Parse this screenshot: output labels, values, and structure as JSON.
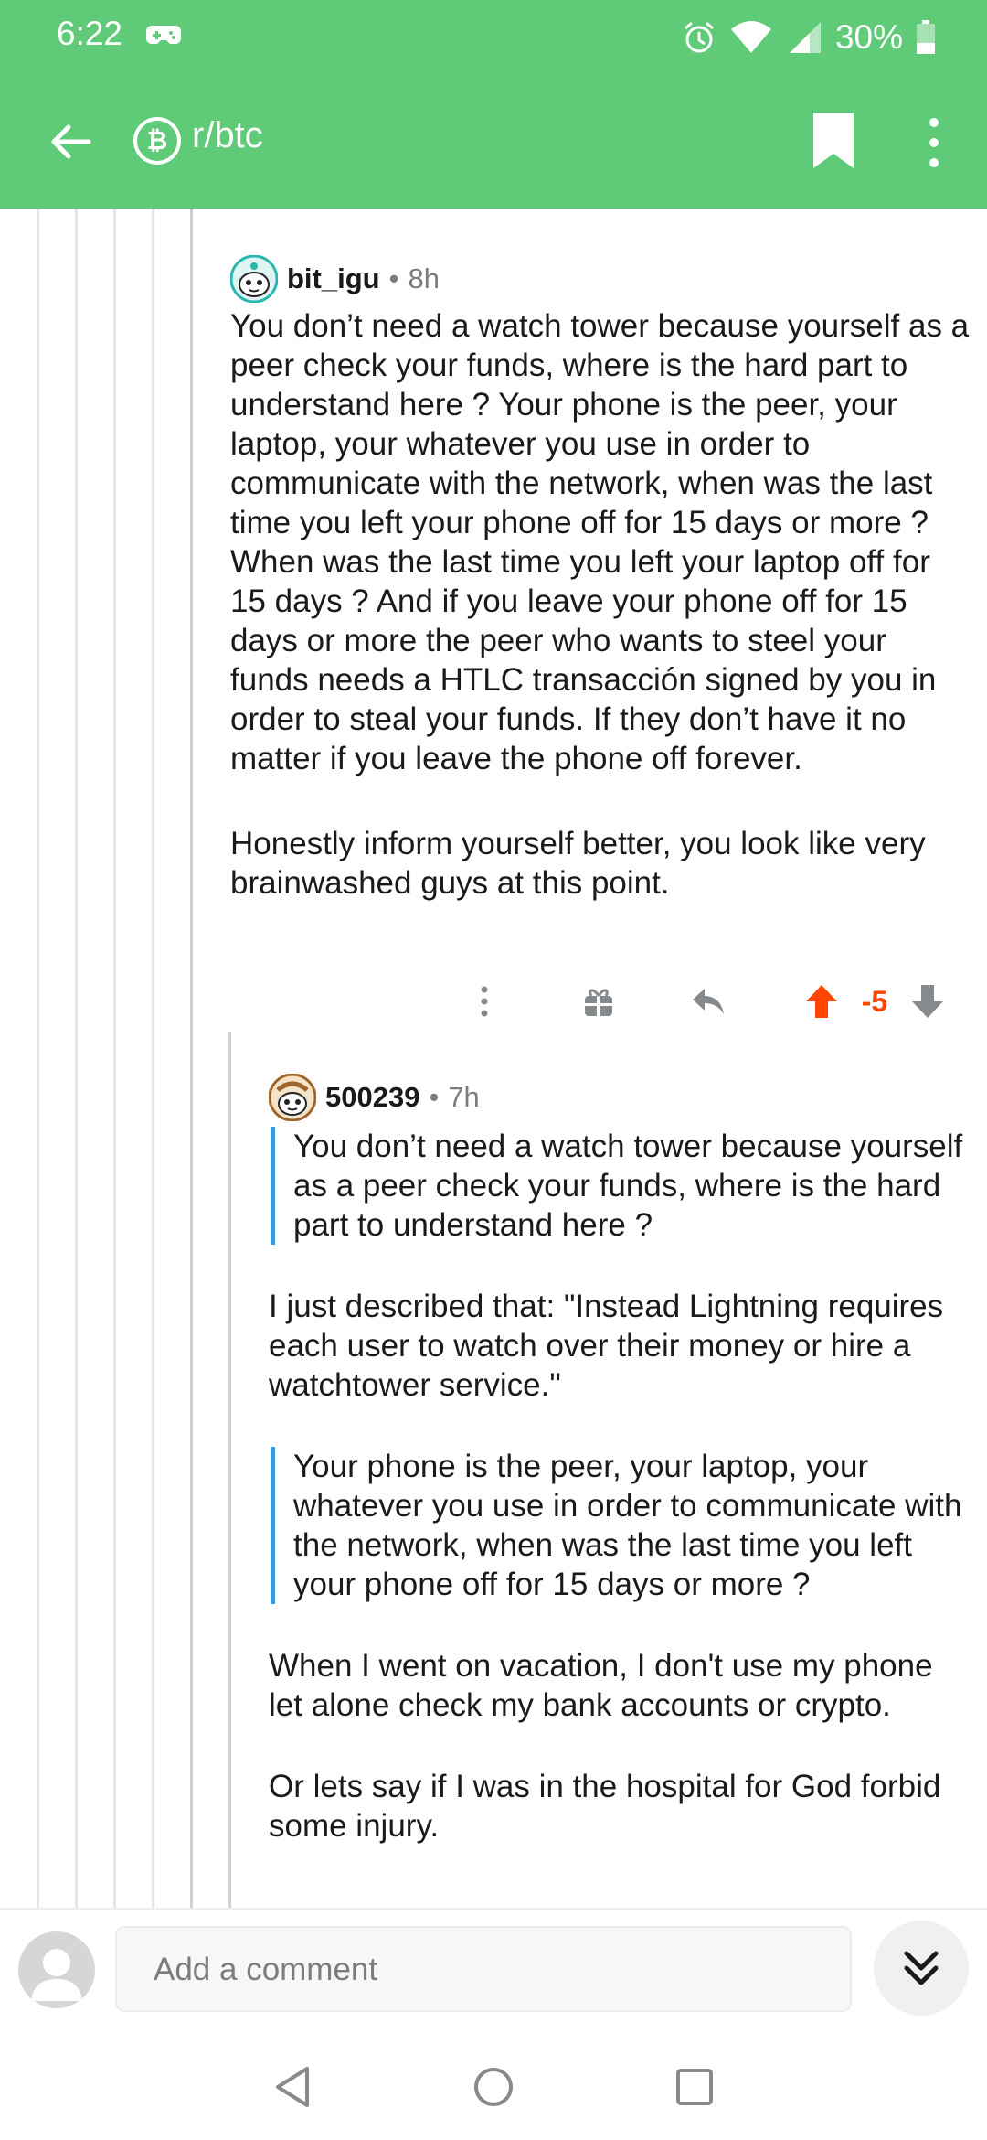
{
  "status": {
    "time": "6:22",
    "battery": "30%"
  },
  "header": {
    "subreddit": "r/btc",
    "sub_icon": "bitcoin-icon"
  },
  "comments": [
    {
      "author": "bit_igu",
      "age": "8h",
      "paragraphs": [
        "You don’t need a watch tower because yourself as a peer check your funds, where is the hard part to understand here ? Your phone is the peer, your laptop, your whatever you use in order to communicate with the network, when was the last time you left your phone off for 15 days or more ? When was the last time you left your laptop off for 15 days ? And if you leave your phone off for 15 days or more the peer who wants to steel your funds  needs a  HTLC transacción signed by you in order to steal your funds. If they don’t have it no matter if you leave the phone off forever.",
        "Honestly inform yourself better, you look like very brainwashed guys at this point."
      ],
      "score": "-5"
    },
    {
      "author": "500239",
      "age": "7h",
      "quote1": "You don’t need a watch tower because yourself as a peer check your funds, where is the hard part to understand here ?",
      "para1": "I just described that: \"Instead Lightning requires each user to watch over their money or hire a watchtower service.\"",
      "quote2": "Your phone is the peer, your laptop, your whatever you use in order to communicate with the network, when was the last time you left your phone off for 15 days or more ?",
      "para2": "When I went on vacation, I don't use my phone let alone check my bank accounts or crypto.",
      "para3": "Or lets say if I was in the hospital for God forbid some injury."
    }
  ],
  "composer": {
    "placeholder": "Add a comment"
  },
  "colors": {
    "header": "#5fca78",
    "upvote": "#ff4500",
    "quote_bar": "#3a9ad9"
  }
}
